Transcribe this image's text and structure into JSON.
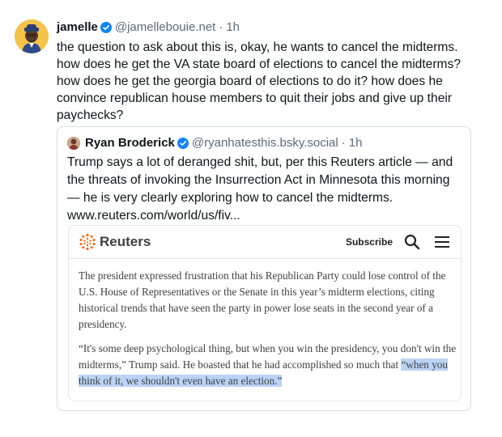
{
  "post": {
    "display_name": "jamelle",
    "handle": "@jamellebouie.net",
    "separator": "·",
    "time": "1h",
    "text": "the question to ask about this is, okay, he wants to cancel the midterms. how does he get the VA state board of elections to cancel the midterms? how does he get the georgia board of elections to do it? how does he convince republican house members to quit their jobs and give up their paychecks?"
  },
  "quote": {
    "display_name": "Ryan Broderick",
    "handle": "@ryanhatesthis.bsky.social",
    "separator": "·",
    "time": "1h",
    "text": "Trump says a lot of deranged shit, but, per this Reuters article — and the threats of invoking the Insurrection Act in Minnesota this morning — he is very clearly exploring how to cancel the midterms.",
    "link": "www.reuters.com/world/us/fiv..."
  },
  "embed": {
    "brand": "Reuters",
    "subscribe_label": "Subscribe",
    "paragraph1": "The president expressed frustration that his Republican Party could lose control of the U.S. House of Representatives or the Senate in this year’s midterm elections, citing historical trends that have seen the party in power lose seats in the second year of a presidency.",
    "paragraph2_plain": "“It's some deep psychological thing, but when you win the presidency, you don't win the midterms,” Trump said. He boasted that he had accomplished so much that ",
    "paragraph2_highlight": "“when you think of it, we shouldn't even have an election.”"
  },
  "colors": {
    "verified": "#1083fe",
    "highlight": "#b9d4f5",
    "reuters_orange": "#fa6400"
  },
  "icons": [
    "verified-badge-icon",
    "reuters-logo-icon",
    "search-icon",
    "menu-icon"
  ]
}
